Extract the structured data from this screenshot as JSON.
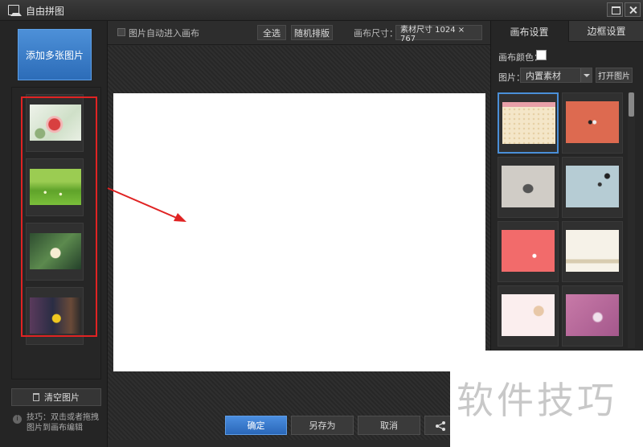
{
  "window": {
    "title": "自由拼图"
  },
  "left_panel": {
    "add_button": "添加多张图片",
    "clear_button": "清空图片",
    "tip_icon": "i",
    "tip": "技巧：双击或者拖拽图片到画布编辑",
    "thumbnails": [
      "red-flower",
      "green-meadow",
      "white-flower",
      "toy-figure"
    ]
  },
  "toolbar": {
    "auto_canvas_label": "图片自动进入画布",
    "select_all": "全选",
    "random_sort": "随机排版",
    "canvas_size_label": "画布尺寸：",
    "canvas_size_value": "素材尺寸 1024 × 767"
  },
  "right_panel": {
    "tabs": [
      "画布设置",
      "边框设置"
    ],
    "active_tab": "画布设置",
    "canvas_color_label": "画布颜色：",
    "canvas_color": "#ffffff",
    "image_label": "图片：",
    "image_source": "内置素材",
    "open_image": "打开图片",
    "backgrounds": [
      "polka-cream",
      "orange-smile",
      "grey-cartoon",
      "blue-dandelion",
      "coral-bird",
      "cream-lace",
      "pink-tree",
      "purple-bokeh"
    ]
  },
  "bottom": {
    "ok": "确定",
    "save_as": "另存为",
    "cancel": "取消"
  },
  "watermark": "软件技巧",
  "colors": {
    "accent": "#2f72c6",
    "highlight": "#e02323"
  }
}
